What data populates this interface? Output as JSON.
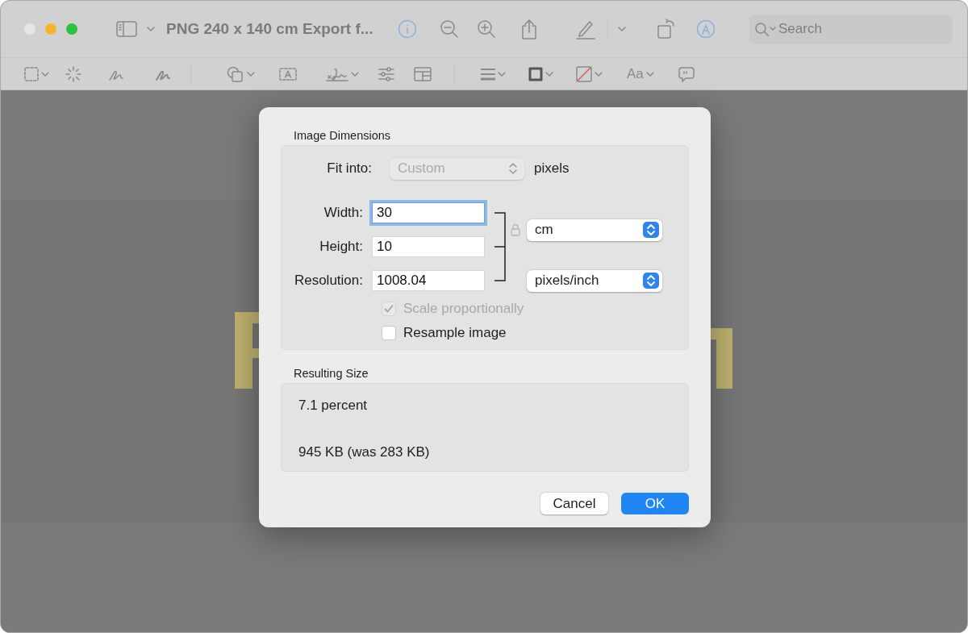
{
  "window": {
    "title": "PNG 240 x 140 cm Export f..."
  },
  "toolbar": {
    "search": {
      "placeholder": "Search"
    }
  },
  "markup_toolbar": {
    "text_style": "Aa"
  },
  "dialog": {
    "dimensions_title": "Image Dimensions",
    "fit_into": {
      "label": "Fit into:",
      "value": "Custom",
      "disabled": true,
      "unit": "pixels"
    },
    "fields": [
      {
        "label": "Width:",
        "value": "30",
        "focused": true
      },
      {
        "label": "Height:",
        "value": "10",
        "focused": false
      },
      {
        "label": "Resolution:",
        "value": "1008.04",
        "focused": false
      }
    ],
    "size_unit": "cm",
    "resolution_unit": "pixels/inch",
    "checkboxes": [
      {
        "label": "Scale proportionally",
        "checked": true,
        "disabled": true
      },
      {
        "label": "Resample image",
        "checked": false,
        "disabled": false
      }
    ],
    "result_title": "Resulting Size",
    "result_lines": [
      "7.1 percent",
      "945 KB (was 283 KB)"
    ],
    "buttons": [
      {
        "label": "Cancel",
        "primary": false
      },
      {
        "label": "OK",
        "primary": true
      }
    ]
  }
}
